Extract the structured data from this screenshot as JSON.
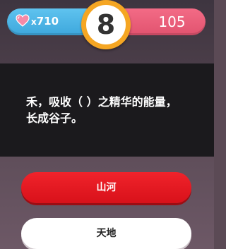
{
  "hud": {
    "lives_prefix": "x",
    "lives_count": "710",
    "timer": "8",
    "score": "105"
  },
  "question": {
    "line1": "禾，吸收（ ）之精华的能量，",
    "line2": "长成谷子。"
  },
  "answers": [
    {
      "label": "山河",
      "state": "selected"
    },
    {
      "label": "天地",
      "state": "default"
    }
  ],
  "colors": {
    "lives_bar": "#4ab3e4",
    "score_bar": "#ea5f7b",
    "timer_ring": "#f5a623",
    "answer_selected": "#e51a22",
    "answer_default": "#ffffff"
  },
  "icons": {
    "lives": "heart-icon"
  }
}
